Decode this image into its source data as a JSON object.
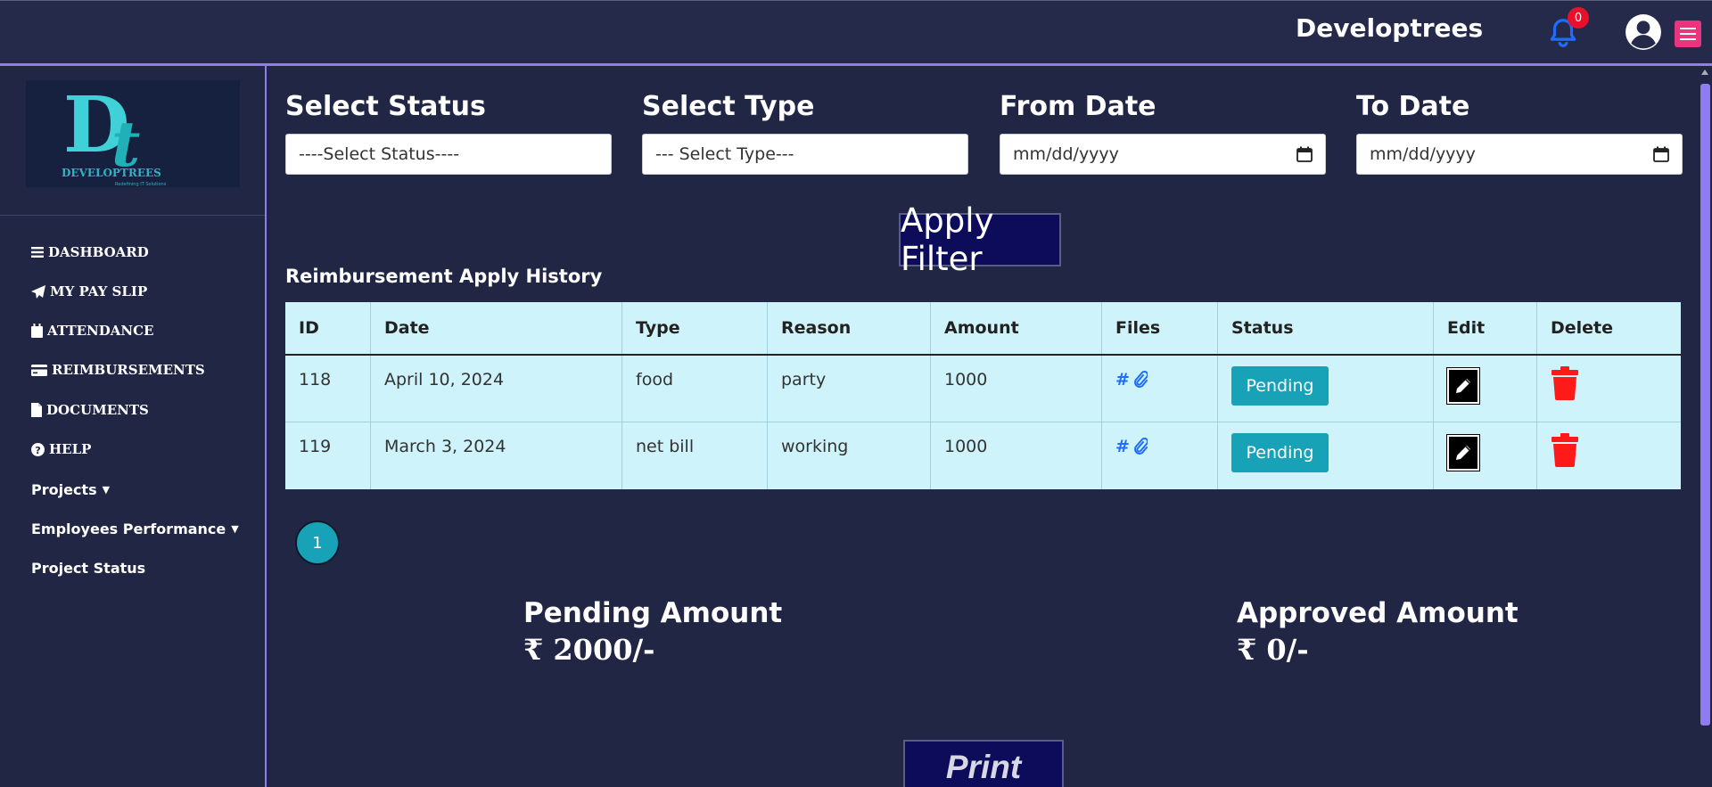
{
  "header": {
    "brand": "Developtrees",
    "notification_count": "0"
  },
  "sidebar": {
    "logo_text": "DEVELOPTREES",
    "logo_tagline": "Redefining IT Solutions",
    "items": [
      {
        "label": "DASHBOARD",
        "icon": "bars-icon"
      },
      {
        "label": "MY PAY SLIP",
        "icon": "paper-plane-icon"
      },
      {
        "label": "ATTENDANCE",
        "icon": "calendar-icon"
      },
      {
        "label": "REIMBURSEMENTS",
        "icon": "credit-card-icon"
      },
      {
        "label": "DOCUMENTS",
        "icon": "file-icon"
      },
      {
        "label": "HELP",
        "icon": "question-circle-icon"
      },
      {
        "label": "Projects",
        "icon": "caret-down-icon"
      },
      {
        "label": "Employees Performance",
        "icon": "caret-down-icon"
      },
      {
        "label": "Project Status",
        "icon": ""
      }
    ]
  },
  "filters": {
    "status_label": "Select Status",
    "status_value": "----Select Status----",
    "type_label": "Select Type",
    "type_value": "--- Select Type---",
    "from_label": "From Date",
    "from_placeholder": "mm/dd/yyyy",
    "to_label": "To Date",
    "to_placeholder": "mm/dd/yyyy",
    "apply_label": "Apply Filter"
  },
  "history": {
    "title": "Reimbursement Apply History",
    "columns": [
      "ID",
      "Date",
      "Type",
      "Reason",
      "Amount",
      "Files",
      "Status",
      "Edit",
      "Delete"
    ],
    "rows": [
      {
        "id": "118",
        "date": "April 10, 2024",
        "type": "food",
        "reason": "party",
        "amount": "1000",
        "files": "#",
        "status": "Pending"
      },
      {
        "id": "119",
        "date": "March 3, 2024",
        "type": "net bill",
        "reason": "working",
        "amount": "1000",
        "files": "#",
        "status": "Pending"
      }
    ]
  },
  "pagination": {
    "current_page": "1"
  },
  "summary": {
    "pending_label": "Pending Amount",
    "pending_value": "₹ 2000/-",
    "approved_label": "Approved Amount",
    "approved_value": "₹ 0/-"
  },
  "print_label": "Print",
  "colors": {
    "background": "#222645",
    "accent": "#8e7cf0",
    "status_badge": "#17a2b8",
    "delete": "#ff1a1a",
    "table_bg": "#cef3fb"
  }
}
